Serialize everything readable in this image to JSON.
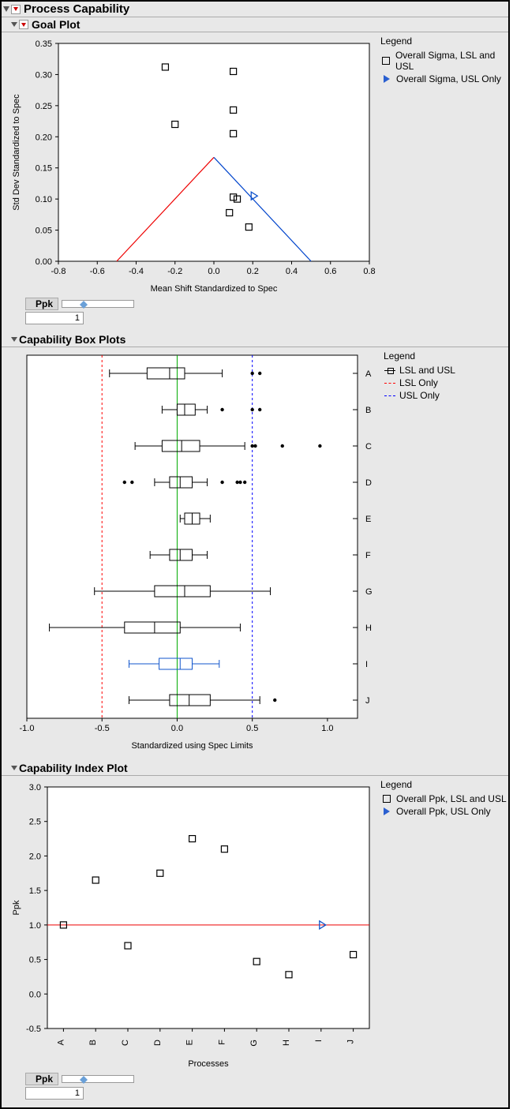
{
  "root_title": "Process Capability",
  "sections": {
    "goal": {
      "title": "Goal Plot",
      "legend_header": "Legend",
      "legend_item_sq": "Overall Sigma, LSL and USL",
      "legend_item_tri": "Overall Sigma, USL Only",
      "ppk_label": "Ppk",
      "ppk_value": "1"
    },
    "box": {
      "title": "Capability Box Plots",
      "legend_header": "Legend",
      "legend_item_black": "LSL and USL",
      "legend_item_red": "LSL Only",
      "legend_item_blue": "USL Only"
    },
    "index": {
      "title": "Capability Index Plot",
      "legend_header": "Legend",
      "legend_item_sq": "Overall Ppk, LSL and USL",
      "legend_item_tri": "Overall Ppk, USL Only",
      "ppk_label": "Ppk",
      "ppk_value": "1"
    }
  },
  "chart_data": [
    {
      "type": "scatter",
      "name": "Goal Plot",
      "xlabel": "Mean Shift Standardized to Spec",
      "ylabel": "Std Dev Standardized to Spec",
      "xlim": [
        -0.8,
        0.8
      ],
      "ylim": [
        0.0,
        0.35
      ],
      "xticks": [
        -0.8,
        -0.6,
        -0.4,
        -0.2,
        0.0,
        0.2,
        0.4,
        0.6,
        0.8
      ],
      "yticks": [
        0.0,
        0.05,
        0.1,
        0.15,
        0.2,
        0.25,
        0.3,
        0.35
      ],
      "triangle_lines": [
        {
          "color": "red",
          "from": [
            -0.5,
            0.0
          ],
          "to": [
            0.0,
            0.167
          ]
        },
        {
          "color": "blue",
          "from": [
            0.0,
            0.167
          ],
          "to": [
            0.5,
            0.0
          ]
        }
      ],
      "series": [
        {
          "name": "Overall Sigma, LSL and USL",
          "marker": "open-square",
          "points": [
            [
              -0.25,
              0.312
            ],
            [
              0.1,
              0.305
            ],
            [
              -0.2,
              0.22
            ],
            [
              0.1,
              0.243
            ],
            [
              0.1,
              0.205
            ],
            [
              0.1,
              0.103
            ],
            [
              0.12,
              0.1
            ],
            [
              0.08,
              0.078
            ],
            [
              0.18,
              0.055
            ]
          ]
        },
        {
          "name": "Overall Sigma, USL Only",
          "marker": "blue-triangle",
          "points": [
            [
              0.2,
              0.105
            ]
          ]
        }
      ]
    },
    {
      "type": "boxplot",
      "name": "Capability Box Plots",
      "xlabel": "Standardized using Spec Limits",
      "xlim": [
        -1.0,
        1.2
      ],
      "xticks": [
        -1.0,
        -0.5,
        0.0,
        0.5,
        1.0
      ],
      "ref_lines": [
        {
          "x": -0.5,
          "color": "red",
          "dash": true
        },
        {
          "x": 0.0,
          "color": "green",
          "dash": false
        },
        {
          "x": 0.5,
          "color": "blue",
          "dash": true
        }
      ],
      "categories": [
        "A",
        "B",
        "C",
        "D",
        "E",
        "F",
        "G",
        "H",
        "I",
        "J"
      ],
      "boxes": [
        {
          "cat": "A",
          "style": "black",
          "whisker_lo": -0.45,
          "q1": -0.2,
          "median": -0.05,
          "q3": 0.05,
          "whisker_hi": 0.3,
          "outliers": [
            0.5,
            0.55
          ]
        },
        {
          "cat": "B",
          "style": "black",
          "whisker_lo": -0.1,
          "q1": 0.0,
          "median": 0.05,
          "q3": 0.12,
          "whisker_hi": 0.2,
          "outliers": [
            0.3,
            0.5,
            0.55
          ]
        },
        {
          "cat": "C",
          "style": "black",
          "whisker_lo": -0.28,
          "q1": -0.1,
          "median": 0.03,
          "q3": 0.15,
          "whisker_hi": 0.45,
          "outliers": [
            0.5,
            0.52,
            0.7,
            0.95
          ]
        },
        {
          "cat": "D",
          "style": "black",
          "whisker_lo": -0.15,
          "q1": -0.05,
          "median": 0.02,
          "q3": 0.1,
          "whisker_hi": 0.2,
          "outliers": [
            -0.35,
            -0.3,
            0.3,
            0.4,
            0.42,
            0.45
          ]
        },
        {
          "cat": "E",
          "style": "black",
          "whisker_lo": 0.02,
          "q1": 0.05,
          "median": 0.1,
          "q3": 0.15,
          "whisker_hi": 0.22,
          "outliers": []
        },
        {
          "cat": "F",
          "style": "black",
          "whisker_lo": -0.18,
          "q1": -0.05,
          "median": 0.02,
          "q3": 0.1,
          "whisker_hi": 0.2,
          "outliers": []
        },
        {
          "cat": "G",
          "style": "black",
          "whisker_lo": -0.55,
          "q1": -0.15,
          "median": 0.05,
          "q3": 0.22,
          "whisker_hi": 0.62,
          "outliers": []
        },
        {
          "cat": "H",
          "style": "black",
          "whisker_lo": -0.85,
          "q1": -0.35,
          "median": -0.15,
          "q3": 0.02,
          "whisker_hi": 0.42,
          "outliers": []
        },
        {
          "cat": "I",
          "style": "blue",
          "whisker_lo": -0.32,
          "q1": -0.12,
          "median": 0.02,
          "q3": 0.1,
          "whisker_hi": 0.28,
          "outliers": []
        },
        {
          "cat": "J",
          "style": "black",
          "whisker_lo": -0.32,
          "q1": -0.05,
          "median": 0.08,
          "q3": 0.22,
          "whisker_hi": 0.55,
          "outliers": [
            0.65
          ]
        }
      ]
    },
    {
      "type": "scatter",
      "name": "Capability Index Plot",
      "xlabel": "Processes",
      "ylabel": "Ppk",
      "ylim": [
        -0.5,
        3.0
      ],
      "yticks": [
        -0.5,
        0.0,
        0.5,
        1.0,
        1.5,
        2.0,
        2.5,
        3.0
      ],
      "categories": [
        "A",
        "B",
        "C",
        "D",
        "E",
        "F",
        "G",
        "H",
        "I",
        "J"
      ],
      "ref_lines": [
        {
          "y": 1.0,
          "color": "red"
        }
      ],
      "series": [
        {
          "name": "Overall Ppk, LSL and USL",
          "marker": "open-square",
          "points": [
            [
              "A",
              1.0
            ],
            [
              "B",
              1.65
            ],
            [
              "C",
              0.7
            ],
            [
              "D",
              1.75
            ],
            [
              "E",
              2.25
            ],
            [
              "F",
              2.1
            ],
            [
              "G",
              0.47
            ],
            [
              "H",
              0.28
            ],
            [
              "J",
              0.57
            ]
          ]
        },
        {
          "name": "Overall Ppk, USL Only",
          "marker": "blue-triangle",
          "points": [
            [
              "I",
              1.0
            ]
          ]
        }
      ]
    }
  ]
}
